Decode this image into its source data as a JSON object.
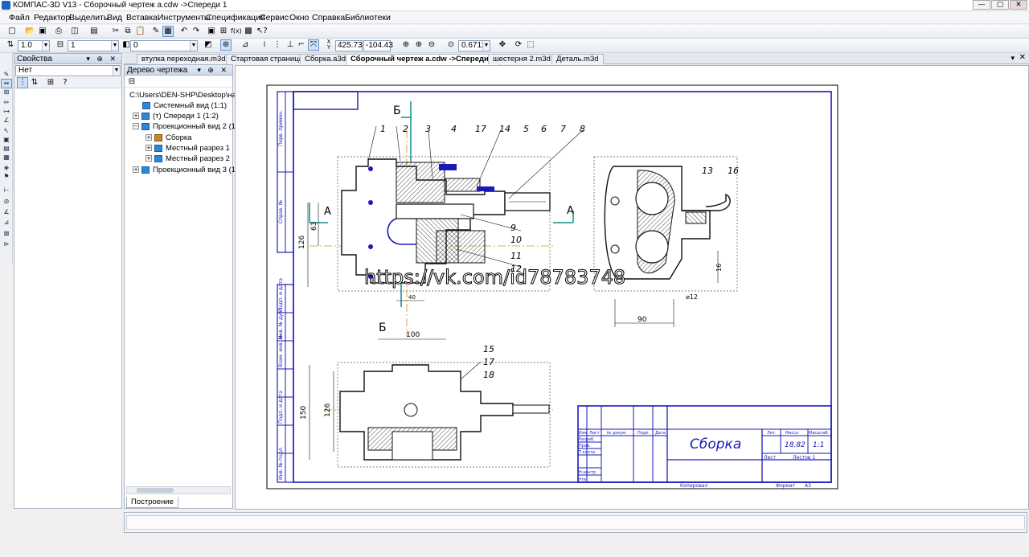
{
  "window": {
    "title": "КОМПАС-3D V13 - Сборочный чертеж a.cdw ->Спереди 1",
    "controls": [
      "—",
      "▢",
      "✕"
    ]
  },
  "menu": [
    "Файл",
    "Редактор",
    "Выделить",
    "Вид",
    "Вставка",
    "Инструменты",
    "Спецификация",
    "Сервис",
    "Окно",
    "Справка",
    "Библиотеки"
  ],
  "toolbar": {
    "scale_value": "1.0",
    "style_value": "1",
    "layer_value": "0",
    "coord_x": "425.73",
    "coord_y": "-104.43",
    "zoom": "0.6711"
  },
  "properties_panel": {
    "title": "Свойства",
    "selected": "Нет"
  },
  "tree_panel": {
    "title": "Дерево чертежа",
    "items": [
      {
        "label": "C:\\Users\\DEN-SHP\\Desktop\\на",
        "expander": ""
      },
      {
        "label": "Системный вид (1:1)",
        "expander": ""
      },
      {
        "label": "(т) Спереди 1 (1:2)",
        "expander": "+"
      },
      {
        "label": "Проекционный вид 2 (1:2)",
        "expander": "−"
      },
      {
        "label": "Сборка",
        "expander": "+"
      },
      {
        "label": "Местный разрез 1",
        "expander": "+"
      },
      {
        "label": "Местный разрез 2",
        "expander": "+"
      },
      {
        "label": "Проекционный вид 3 (1:2)",
        "expander": "+"
      }
    ],
    "bottom_tab": "Построение"
  },
  "doc_tabs": [
    {
      "label": "втулка переходная.m3d",
      "active": false
    },
    {
      "label": "Стартовая страница",
      "active": false
    },
    {
      "label": "Сборка.a3d",
      "active": false
    },
    {
      "label": "Сборочный чертеж a.cdw ->Спереди 1",
      "active": true
    },
    {
      "label": "шестерня 2.m3d",
      "active": false
    },
    {
      "label": "Деталь.m3d",
      "active": false
    }
  ],
  "drawing": {
    "watermark": "https://vk.com/id78783748",
    "title_block_name": "Сборка",
    "mass": "18.82",
    "scale": "1:1",
    "sheet": "Лист",
    "sheets": "Листов 1",
    "copied": "Копировал",
    "format": "Формат",
    "format_value": "А3",
    "column_headers": [
      "Изм",
      "Лист",
      "№ докум.",
      "Подп.",
      "Дата"
    ],
    "row_labels": [
      "Разраб.",
      "Пров.",
      "Т.контр.",
      "Н.контр.",
      "Утв."
    ],
    "meta_headers": [
      "Лит.",
      "Масса",
      "Масштаб"
    ],
    "section_labels": [
      "А",
      "А",
      "Б",
      "Б"
    ],
    "dimensions": [
      "126",
      "63",
      "100",
      "40",
      "126",
      "150",
      "90",
      "16",
      "⌀12"
    ],
    "balloons": [
      "1",
      "2",
      "3",
      "4",
      "17",
      "14",
      "5",
      "6",
      "7",
      "8",
      "9",
      "10",
      "11",
      "12",
      "13",
      "16",
      "15",
      "17",
      "18"
    ],
    "side_labels": [
      "Перв. примен.",
      "Справ. №",
      "Подп. и дата",
      "Инв. № дубл.",
      "Взам. инв. №",
      "Подп. и дата",
      "Инв. № подл."
    ]
  },
  "statusbar": {
    "text": ""
  }
}
